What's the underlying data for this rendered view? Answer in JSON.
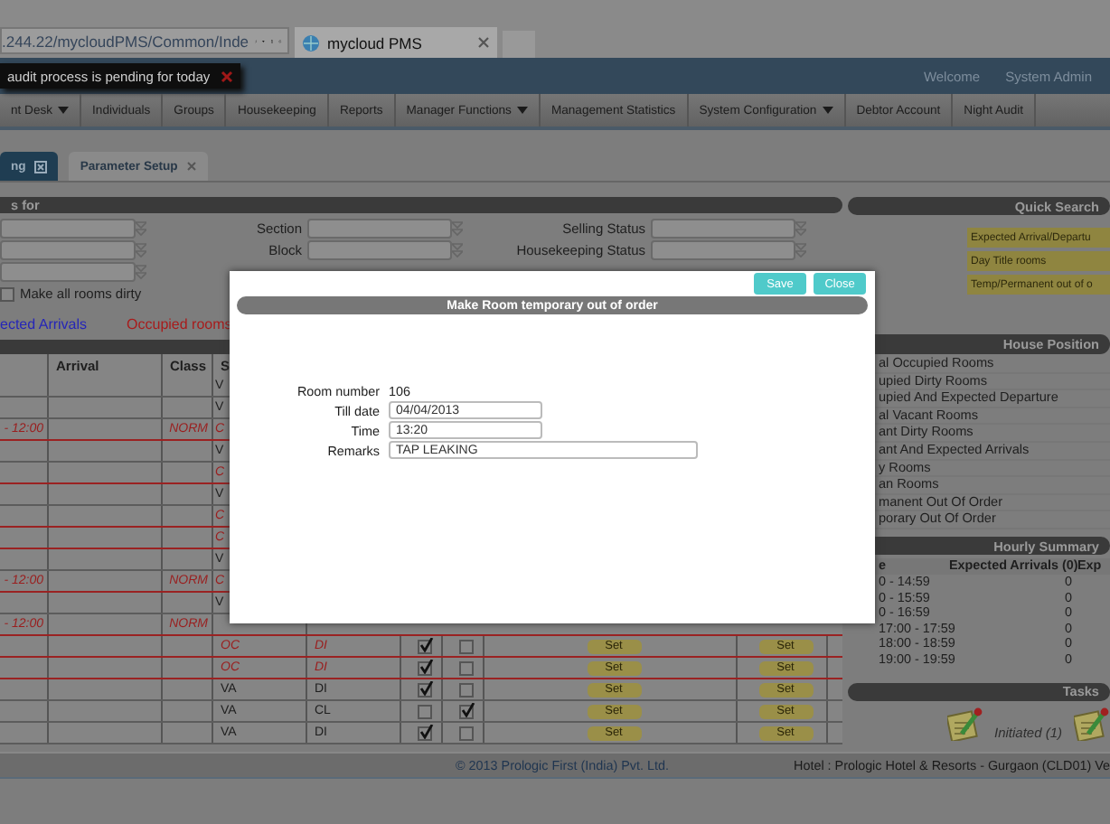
{
  "browser": {
    "address": ".244.22/mycloudPMS/Common/Inde",
    "tab": {
      "title": "mycloud PMS"
    }
  },
  "notification": {
    "text": "audit process is pending for today"
  },
  "header": {
    "welcome": "Welcome",
    "user": "System Admin"
  },
  "menu": [
    {
      "label": "nt Desk",
      "dropdown": true
    },
    {
      "label": "Individuals",
      "dropdown": false
    },
    {
      "label": "Groups",
      "dropdown": false
    },
    {
      "label": "Housekeeping",
      "dropdown": false
    },
    {
      "label": "Reports",
      "dropdown": false
    },
    {
      "label": "Manager Functions",
      "dropdown": true
    },
    {
      "label": "Management Statistics",
      "dropdown": false
    },
    {
      "label": "System Configuration",
      "dropdown": true
    },
    {
      "label": "Debtor Account",
      "dropdown": false
    },
    {
      "label": "Night Audit",
      "dropdown": false
    }
  ],
  "page_tabs": [
    {
      "label": "ng",
      "selected": true
    },
    {
      "label": "Parameter Setup",
      "selected": false
    }
  ],
  "filter": {
    "title": "s for",
    "section_label": "Section",
    "block_label": "Block",
    "selling_label": "Selling Status",
    "housekeeping_label": "Housekeeping Status",
    "dirty": {
      "label": "Make all rooms dirty",
      "checked": false
    }
  },
  "legend": [
    {
      "label": "ected Arrivals",
      "color": "#2626b8"
    },
    {
      "label": "Occupied rooms",
      "color": "#a81c1c"
    }
  ],
  "table": {
    "columns": [
      "Arrival",
      "Class",
      "S"
    ],
    "rows": [
      {
        "kind": "covered",
        "occupied": false,
        "status": "V"
      },
      {
        "kind": "covered",
        "occupied": false,
        "status": "V"
      },
      {
        "kind": "covered",
        "occupied": true,
        "time": "- 12:00",
        "class": "NORM",
        "status": "C"
      },
      {
        "kind": "covered",
        "occupied": false,
        "status": "V"
      },
      {
        "kind": "covered",
        "occupied": true,
        "status": "C"
      },
      {
        "kind": "covered",
        "occupied": false,
        "status": "V"
      },
      {
        "kind": "covered",
        "occupied": true,
        "status": "C"
      },
      {
        "kind": "covered",
        "occupied": true,
        "status": "C"
      },
      {
        "kind": "covered",
        "occupied": false,
        "status": "V"
      },
      {
        "kind": "covered",
        "occupied": true,
        "time": "- 12:00",
        "class": "NORM",
        "status": "C"
      },
      {
        "kind": "covered",
        "occupied": false,
        "status": "V"
      },
      {
        "kind": "covered",
        "occupied": true,
        "time": "- 12:00",
        "class": "NORM"
      },
      {
        "kind": "full",
        "occupied": true,
        "status": "OC",
        "hk": "DI",
        "check_1": true,
        "check_2": false,
        "set_1": "Set",
        "set_2": "Set"
      },
      {
        "kind": "full",
        "occupied": true,
        "status": "OC",
        "hk": "DI",
        "check_1": true,
        "check_2": false,
        "set_1": "Set",
        "set_2": "Set"
      },
      {
        "kind": "full",
        "occupied": false,
        "status": "VA",
        "hk": "DI",
        "check_1": true,
        "check_2": false,
        "set_1": "Set",
        "set_2": "Set"
      },
      {
        "kind": "full",
        "occupied": false,
        "status": "VA",
        "hk": "CL",
        "check_1": false,
        "check_2": true,
        "set_1": "Set",
        "set_2": "Set"
      },
      {
        "kind": "full",
        "occupied": false,
        "status": "VA",
        "hk": "DI",
        "check_1": true,
        "check_2": false,
        "set_1": "Set",
        "set_2": "Set"
      }
    ]
  },
  "quick_search": {
    "title": "Quick Search",
    "buttons": [
      "Expected Arrival/Departu",
      "Day Title rooms",
      "Temp/Permanent out of o"
    ]
  },
  "house_position": {
    "title": "House Position",
    "items": [
      "al Occupied Rooms",
      "upied Dirty Rooms",
      "upied And Expected Departure",
      "al Vacant Rooms",
      "ant Dirty Rooms",
      "ant And Expected Arrivals",
      "y Rooms",
      "an Rooms",
      "manent Out Of Order",
      "porary Out Of Order"
    ]
  },
  "hourly_summary": {
    "title": "Hourly Summary",
    "columns": [
      "e",
      "Expected Arrivals (0)",
      "Exp"
    ],
    "rows": [
      {
        "time": "0 - 14:59",
        "arrivals": "0"
      },
      {
        "time": "0 - 15:59",
        "arrivals": "0"
      },
      {
        "time": "0 - 16:59",
        "arrivals": "0"
      },
      {
        "time": "17:00 - 17:59",
        "arrivals": "0"
      },
      {
        "time": "18:00 - 18:59",
        "arrivals": "0"
      },
      {
        "time": "19:00 - 19:59",
        "arrivals": "0"
      }
    ]
  },
  "tasks": {
    "title": "Tasks",
    "initiated": "Initiated (1)"
  },
  "footer": {
    "copyright": "© 2013 Prologic First (India) Pvt. Ltd.",
    "hotel": "Hotel : Prologic Hotel & Resorts - Gurgaon (CLD01)  Ve"
  },
  "dialog": {
    "title": "Make Room temporary out of order",
    "buttons": [
      "Save",
      "Close"
    ],
    "room_label": "Room number",
    "room": "106",
    "till_label": "Till date",
    "till": "04/04/2013",
    "time_label": "Time",
    "time": "13:20",
    "remarks_label": "Remarks",
    "remarks": "TAP LEAKING"
  }
}
